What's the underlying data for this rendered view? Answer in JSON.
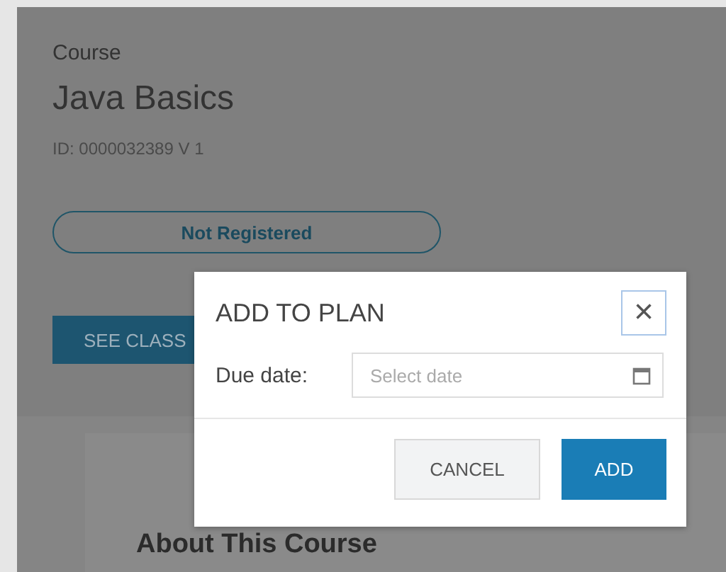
{
  "course": {
    "label": "Course",
    "title": "Java Basics",
    "id": "ID: 0000032389  V 1",
    "status": "Not Registered",
    "button": "SEE CLASS",
    "about": "About This Course"
  },
  "dialog": {
    "title": "ADD TO PLAN",
    "close": "×",
    "due_label": "Due date:",
    "due_field": {
      "placeholder": "Select date"
    },
    "buttons": [
      {
        "label": "CANCEL",
        "kind": "secondary"
      },
      {
        "label": "ADD",
        "kind": "primary"
      }
    ]
  }
}
